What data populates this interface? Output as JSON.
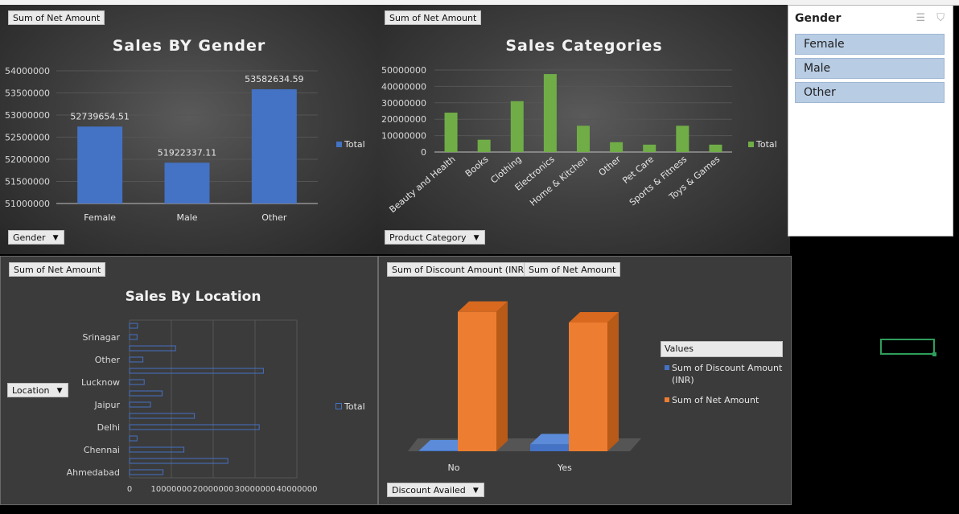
{
  "charts": {
    "gender": {
      "field_button": "Sum of Net Amount",
      "title": "Sales BY Gender",
      "axis_button": "Gender",
      "legend": "Total",
      "y_ticks": [
        "54000000",
        "53500000",
        "53000000",
        "52500000",
        "52000000",
        "51500000",
        "51000000"
      ],
      "x_labels": [
        "Female",
        "Male",
        "Other"
      ],
      "value_labels": [
        "52739654.51",
        "51922337.11",
        "53582634.59"
      ]
    },
    "category": {
      "field_button": "Sum of Net Amount",
      "title": "Sales Categories",
      "axis_button": "Product Category",
      "legend": "Total",
      "y_ticks": [
        "50000000",
        "40000000",
        "30000000",
        "20000000",
        "10000000",
        "0"
      ],
      "x_labels": [
        "Beauty and Health",
        "Books",
        "Clothing",
        "Electronics",
        "Home & Kitchen",
        "Other",
        "Pet Care",
        "Sports & Fitness",
        "Toys & Games"
      ]
    },
    "location": {
      "field_button": "Sum of Net Amount",
      "title": "Sales By Location",
      "axis_button": "Location",
      "legend": "Total",
      "y_labels": [
        "Srinagar",
        "Other",
        "Lucknow",
        "Jaipur",
        "Delhi",
        "Chennai",
        "Ahmedabad"
      ],
      "x_ticks": [
        "0",
        "10000000",
        "20000000",
        "30000000",
        "40000000"
      ]
    },
    "discount": {
      "field_button_1": "Sum of Discount Amount (INR)",
      "field_button_2": "Sum of Net Amount",
      "axis_button": "Discount Availed",
      "legend_title": "Values",
      "legend_items": [
        "Sum of Discount Amount (INR)",
        "Sum of Net Amount"
      ],
      "x_labels": [
        "No",
        "Yes"
      ]
    }
  },
  "slicer": {
    "title": "Gender",
    "items": [
      "Female",
      "Male",
      "Other"
    ]
  },
  "colors": {
    "blue_bar": "#4472c4",
    "green_bar": "#70ad47",
    "orange_bar": "#ed7d31"
  },
  "chart_data": [
    {
      "type": "bar",
      "title": "Sales BY Gender",
      "categories": [
        "Female",
        "Male",
        "Other"
      ],
      "series": [
        {
          "name": "Total",
          "values": [
            52739654.51,
            51922337.11,
            53582634.59
          ]
        }
      ],
      "ylim": [
        51000000,
        54000000
      ],
      "legend": "right"
    },
    {
      "type": "bar",
      "title": "Sales Categories",
      "categories": [
        "Beauty and Health",
        "Books",
        "Clothing",
        "Electronics",
        "Home & Kitchen",
        "Other",
        "Pet Care",
        "Sports & Fitness",
        "Toys & Games"
      ],
      "series": [
        {
          "name": "Total",
          "values": [
            24000000,
            7500000,
            31000000,
            47500000,
            16000000,
            6000000,
            4500000,
            16000000,
            4500000
          ]
        }
      ],
      "ylim": [
        0,
        50000000
      ],
      "legend": "right"
    },
    {
      "type": "bar",
      "orientation": "horizontal",
      "title": "Sales By Location",
      "categories": [
        "Ahmedabad",
        "",
        "Chennai",
        "",
        "Delhi",
        "",
        "Jaipur",
        "",
        "Lucknow",
        "",
        "Other",
        "",
        "Srinagar",
        ""
      ],
      "series": [
        {
          "name": "Total",
          "values": [
            8000000,
            23500000,
            13000000,
            1800000,
            31000000,
            15500000,
            5000000,
            7800000,
            3500000,
            32000000,
            3200000,
            11000000,
            1800000,
            1900000
          ]
        }
      ],
      "xlim": [
        0,
        40000000
      ],
      "legend": "right"
    },
    {
      "type": "bar",
      "style": "3d",
      "categories": [
        "No",
        "Yes"
      ],
      "series": [
        {
          "name": "Sum of Discount Amount (INR)",
          "values": [
            0,
            2600000
          ]
        },
        {
          "name": "Sum of Net Amount",
          "values": [
            52000000,
            48000000
          ]
        }
      ],
      "legend": "right"
    }
  ]
}
